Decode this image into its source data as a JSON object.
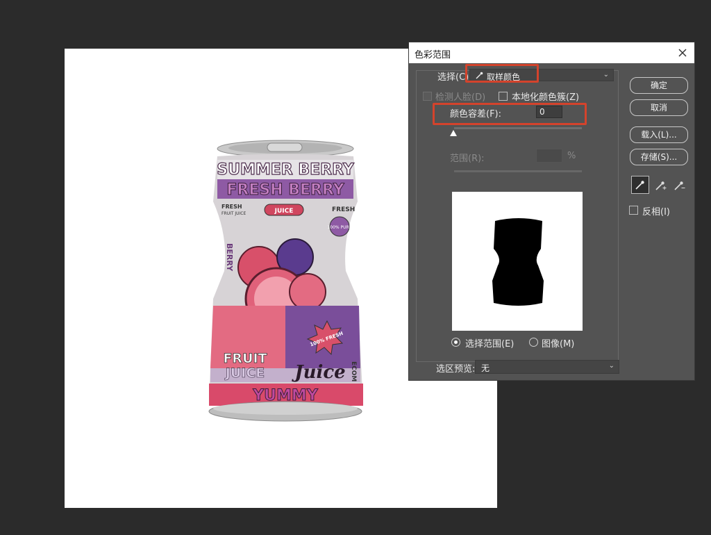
{
  "canvas": {
    "can_print": {
      "title_1": "SUMMER BERRY",
      "title_2": "FRESH BERRY",
      "small_1": "FRESH",
      "small_2": "FRUIT JUICE",
      "badge_juice": "JUICE",
      "fresh_right": "FRESH",
      "pure": "100% PURE",
      "berry_side": "BERRY",
      "burst": "100% FRESH",
      "fruit": "FRUIT",
      "juice_word": "JUICE",
      "juice_script": "Juice",
      "yummy": "YUMMY",
      "side_right": "ECOM"
    }
  },
  "dialog": {
    "title": "色彩范围",
    "select_label": "选择(C):",
    "select_value": "取样颜色",
    "detect_faces_label": "检测人脸(D)",
    "localized_label": "本地化颜色簇(Z)",
    "fuzziness_label": "颜色容差(F):",
    "fuzziness_value": "0",
    "range_label": "范围(R):",
    "range_value": "",
    "range_unit": "%",
    "radio_selection": "选择范围(E)",
    "radio_image": "图像(M)",
    "preview_label": "选区预览:",
    "preview_value": "无",
    "buttons": {
      "ok": "确定",
      "cancel": "取消",
      "load": "载入(L)...",
      "save": "存储(S)..."
    },
    "invert_label": "反相(I)",
    "highlight_color": "#d4432c"
  }
}
